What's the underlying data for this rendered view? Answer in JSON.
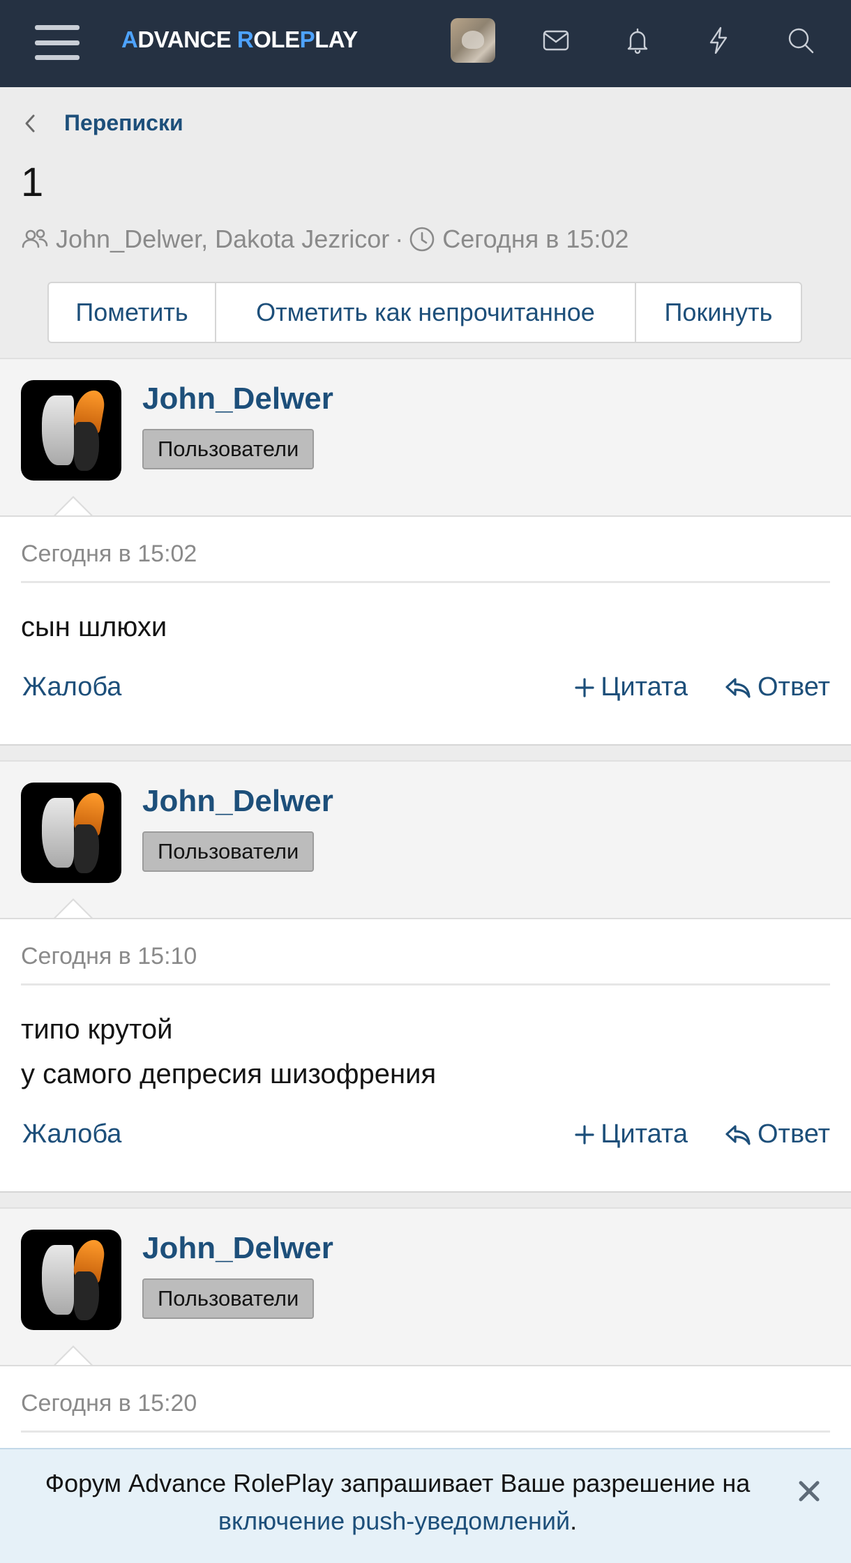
{
  "app": {
    "logo": {
      "part1": "A",
      "part2": "DVANCE ",
      "part3": "R",
      "part4": "OLE",
      "part5": "P",
      "part6": "LAY"
    }
  },
  "topbar": {
    "icons": [
      "menu-icon",
      "user-avatar",
      "inbox-icon",
      "bell-icon",
      "bolt-icon",
      "search-icon"
    ]
  },
  "breadcrumb": {
    "label": "Переписки"
  },
  "conversation": {
    "title": "1",
    "participants": "John_Delwer, Dakota Jezricor",
    "separator": "·",
    "started": "Сегодня в 15:02",
    "actions": [
      "Пометить",
      "Отметить как непрочитанное",
      "Покинуть"
    ]
  },
  "messages": [
    {
      "author": "John_Delwer",
      "group": "Пользователи",
      "time": "Сегодня в 15:02",
      "lines": [
        "сын шлюхи"
      ],
      "report": "Жалоба",
      "quote": "Цитата",
      "reply": "Ответ"
    },
    {
      "author": "John_Delwer",
      "group": "Пользователи",
      "time": "Сегодня в 15:10",
      "lines": [
        "типо крутой",
        "у самого депресия шизофрения"
      ],
      "report": "Жалоба",
      "quote": "Цитата",
      "reply": "Ответ"
    },
    {
      "author": "John_Delwer",
      "group": "Пользователи",
      "time": "Сегодня в 15:20",
      "lines": [],
      "report": "",
      "quote": "",
      "reply": ""
    }
  ],
  "push_notice": {
    "text_before": "Форум Advance RolePlay запрашивает Ваше разрешение на ",
    "link": "включение push-уведомлений",
    "text_after": "."
  },
  "colors": {
    "topbar": "#253142",
    "accent_link": "#1d4f7a",
    "logo_highlight": "#4ea3ff",
    "page_background": "#ececec"
  }
}
